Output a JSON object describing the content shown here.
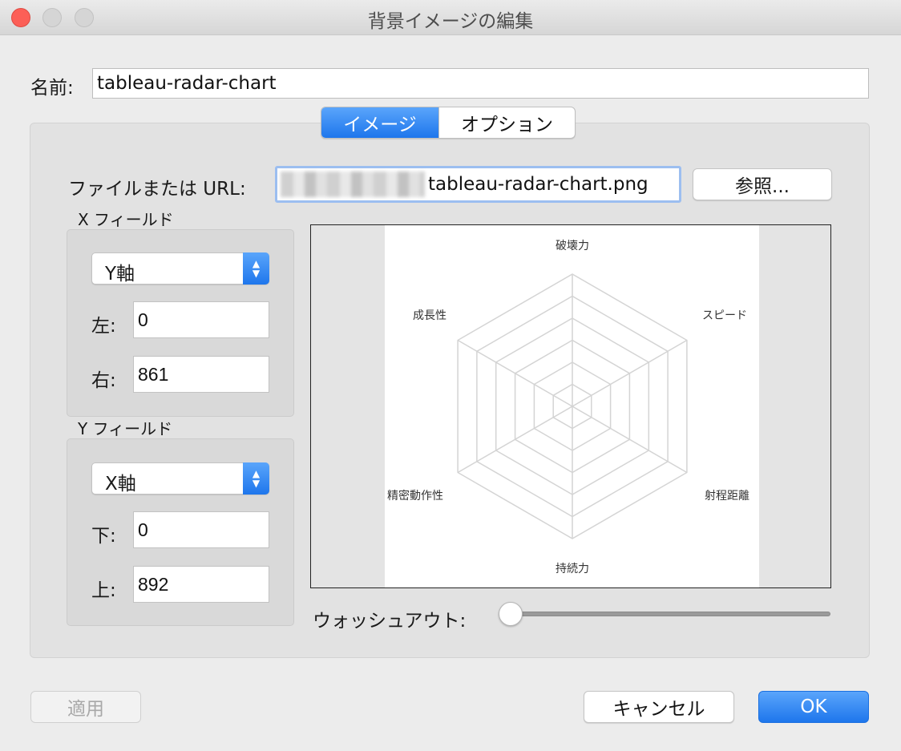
{
  "window": {
    "title": "背景イメージの編集"
  },
  "name": {
    "label": "名前:",
    "value": "tableau-radar-chart"
  },
  "tabs": [
    {
      "label": "イメージ",
      "active": true
    },
    {
      "label": "オプション",
      "active": false
    }
  ],
  "file": {
    "label": "ファイルまたは URL:",
    "filename": "tableau-radar-chart.png",
    "browse_label": "参照..."
  },
  "x_field": {
    "group_label": "X フィールド",
    "selected": "Y軸",
    "left_label": "左:",
    "left_value": "0",
    "right_label": "右:",
    "right_value": "861"
  },
  "y_field": {
    "group_label": "Y フィールド",
    "selected": "X軸",
    "bottom_label": "下:",
    "bottom_value": "0",
    "top_label": "上:",
    "top_value": "892"
  },
  "preview": {
    "axis_labels": [
      "破壊力",
      "スピード",
      "射程距離",
      "持続力",
      "精密動作性",
      "成長性"
    ]
  },
  "washout": {
    "label": "ウォッシュアウト:",
    "value": 0
  },
  "buttons": {
    "apply": "適用",
    "cancel": "キャンセル",
    "ok": "OK"
  },
  "colors": {
    "accent": "#1e76ec",
    "close": "#fc5f57"
  }
}
